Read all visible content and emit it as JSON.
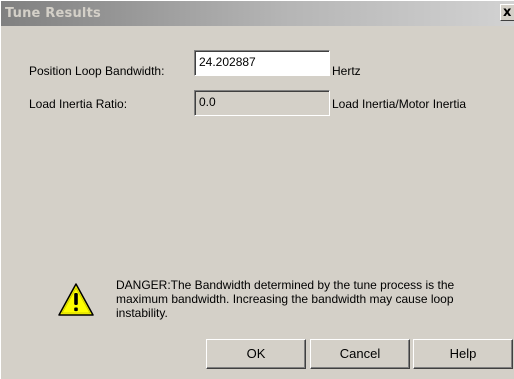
{
  "window": {
    "title": "Tune Results",
    "close_glyph": "x"
  },
  "fields": {
    "bandwidth": {
      "label": "Position Loop Bandwidth:",
      "value": "24.202887",
      "unit": "Hertz"
    },
    "inertia": {
      "label": "Load Inertia Ratio:",
      "value": "0.0",
      "unit": "Load Inertia/Motor Inertia"
    }
  },
  "warning": {
    "icon": "warning-icon",
    "text": "DANGER:The Bandwidth determined by the tune process is the maximum bandwidth. Increasing the bandwidth may cause loop instability."
  },
  "buttons": {
    "ok": "OK",
    "cancel": "Cancel",
    "help": "Help"
  },
  "colors": {
    "dialog_bg": "#d4d0c8",
    "warning_yellow": "#ffff00"
  }
}
